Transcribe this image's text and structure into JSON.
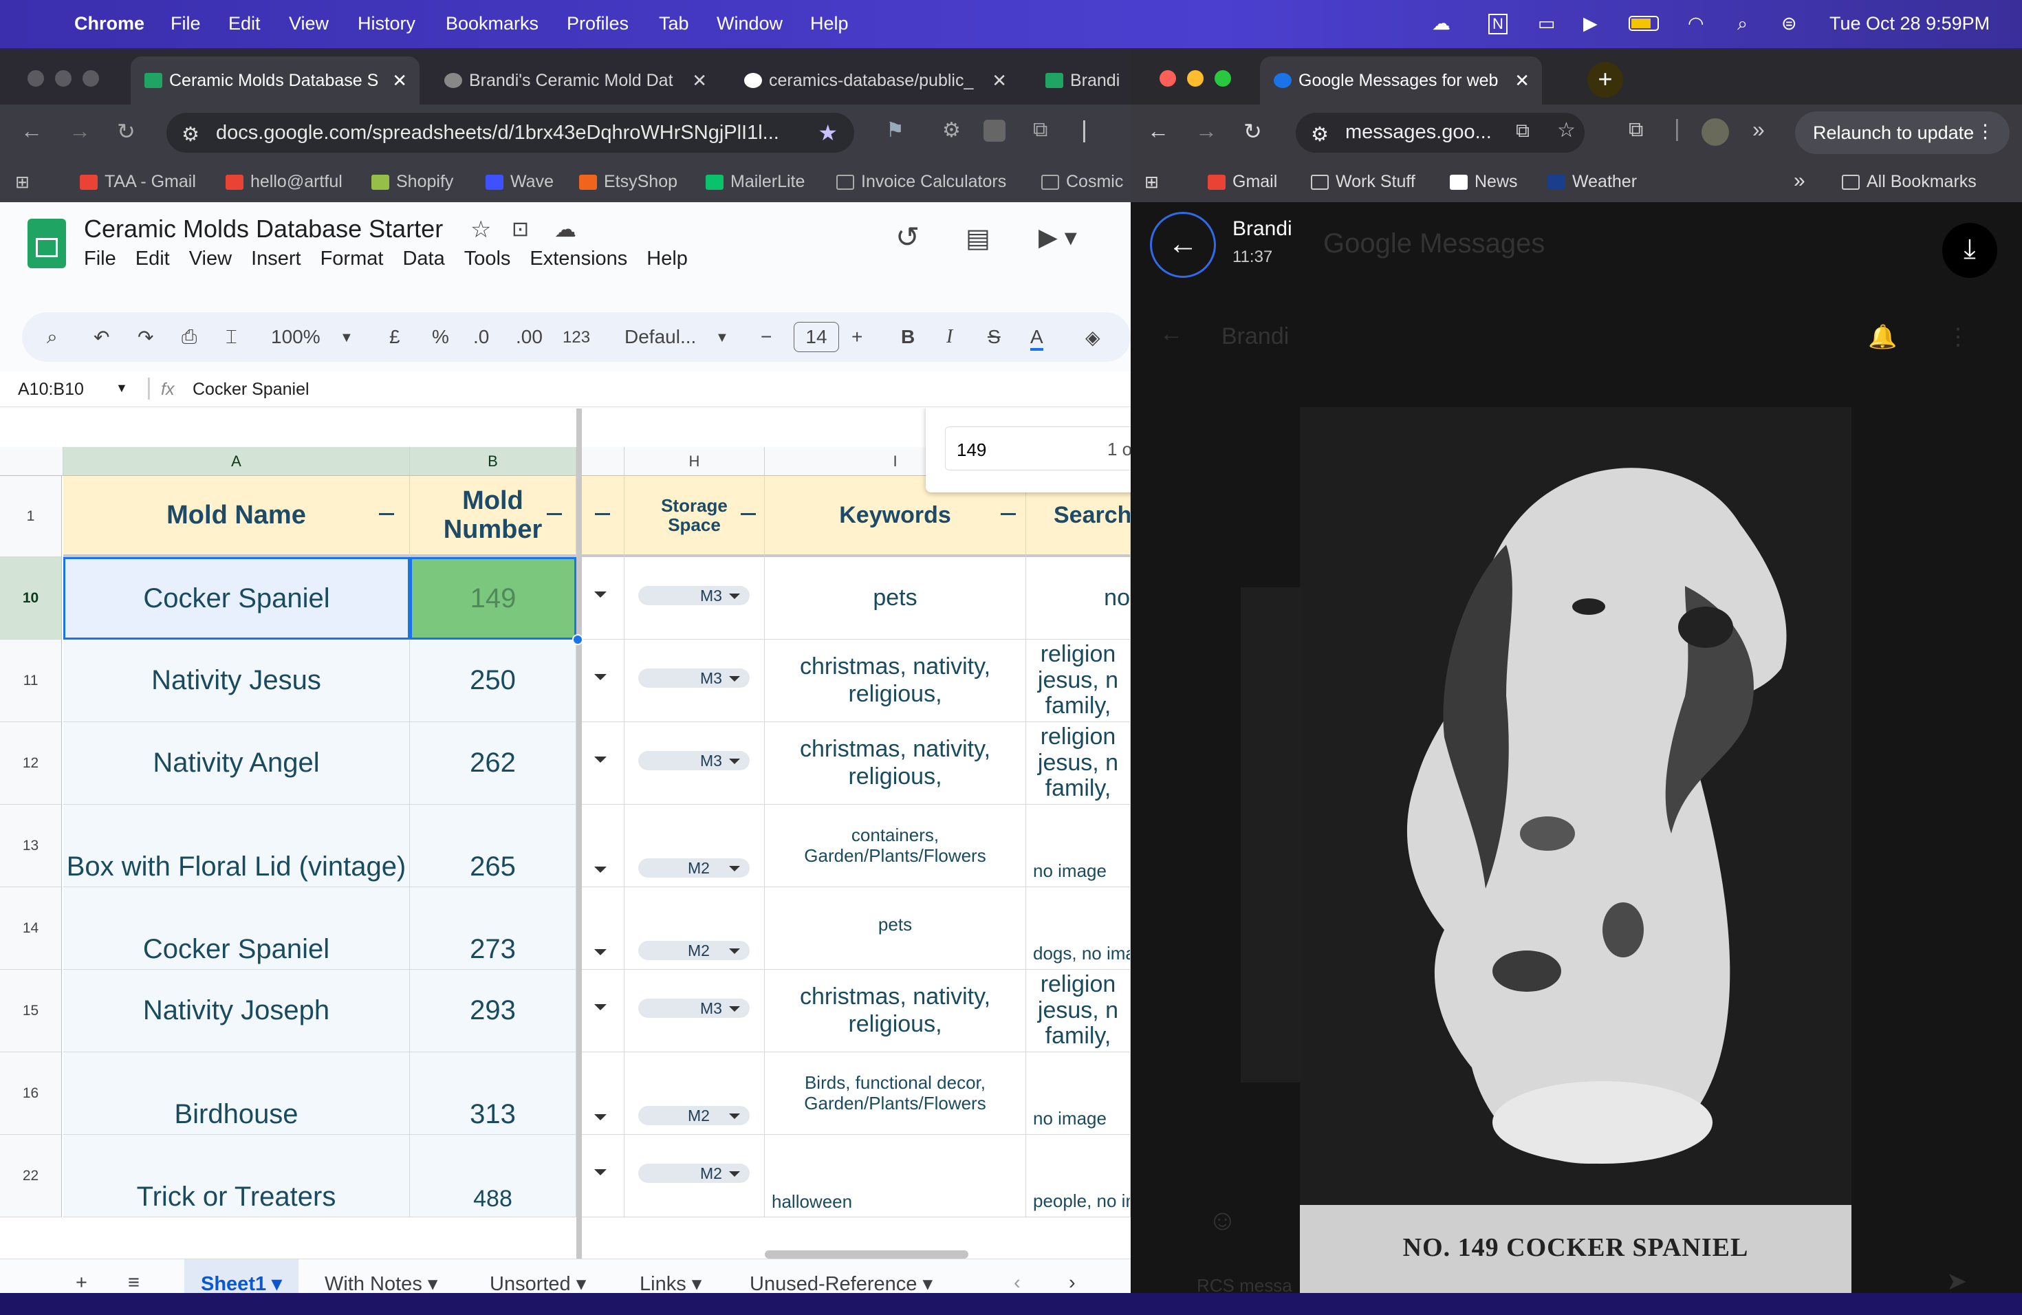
{
  "menubar": {
    "app": "Chrome",
    "items": [
      "File",
      "Edit",
      "View",
      "History",
      "Bookmarks",
      "Profiles",
      "Tab",
      "Window",
      "Help"
    ],
    "datetime": "Tue Oct 28  9:59PM"
  },
  "left": {
    "tabs": [
      "Ceramic Molds Database S",
      "Brandi's Ceramic Mold Dat",
      "ceramics-database/public_",
      "Brandi"
    ],
    "url": "docs.google.com/spreadsheets/d/1brx43eDqhroWHrSNgjPlI1l...",
    "bookmarks": [
      "TAA - Gmail",
      "hello@artful",
      "Shopify",
      "Wave",
      "EtsyShop",
      "MailerLite",
      "Invoice Calculators",
      "Cosmic"
    ],
    "doc_title": "Ceramic Molds Database Starter",
    "menus": [
      "File",
      "Edit",
      "View",
      "Insert",
      "Format",
      "Data",
      "Tools",
      "Extensions",
      "Help"
    ],
    "toolbar": {
      "zoom": "100%",
      "currency": "£",
      "percent": "%",
      "dec_less": ".0",
      "dec_more": ".00",
      "num_fmt": "123",
      "font": "Defaul...",
      "size": "14",
      "bold": "B",
      "italic": "I",
      "strike": "S",
      "color": "A"
    },
    "name_box": "A10:B10",
    "formula": "Cocker Spaniel",
    "find_value": "149",
    "find_count": "1 o",
    "col_headers": [
      "A",
      "B",
      "H",
      "I"
    ],
    "headers": {
      "a": "Mold Name",
      "b1": "Mold",
      "b2": "Number",
      "h1": "Storage",
      "h2": "Space",
      "i": "Keywords",
      "j": "Search"
    },
    "rows": [
      {
        "num": "10",
        "name": "Cocker Spaniel",
        "mold": "149",
        "storage": "M3",
        "kw": "pets",
        "search": "no"
      },
      {
        "num": "11",
        "name": "Nativity Jesus",
        "mold": "250",
        "storage": "M3",
        "kw": "christmas, nativity, religious,",
        "search": "religion jesus, n family,"
      },
      {
        "num": "12",
        "name": "Nativity Angel",
        "mold": "262",
        "storage": "M3",
        "kw": "christmas, nativity, religious,",
        "search": "religion jesus, n family,"
      },
      {
        "num": "13",
        "name": "Box with Floral Lid (vintage)",
        "mold": "265",
        "storage": "M2",
        "kw": "containers, Garden/Plants/Flowers",
        "search": "no image"
      },
      {
        "num": "14",
        "name": "Cocker Spaniel",
        "mold": "273",
        "storage": "M2",
        "kw": "pets",
        "search": "dogs, no ima"
      },
      {
        "num": "15",
        "name": "Nativity Joseph",
        "mold": "293",
        "storage": "M3",
        "kw": "christmas, nativity, religious,",
        "search": "religion jesus, n family,"
      },
      {
        "num": "16",
        "name": "Birdhouse",
        "mold": "313",
        "storage": "M2",
        "kw": "Birds, functional decor, Garden/Plants/Flowers",
        "search": "no image"
      },
      {
        "num": "22",
        "name": "Trick or Treaters",
        "mold": "488",
        "storage": "M2",
        "kw": "halloween",
        "search": "people, no im"
      }
    ],
    "sheet_tabs": [
      "Sheet1",
      "With Notes",
      "Unsorted",
      "Links",
      "Unused-Reference"
    ],
    "add_sheet": "+"
  },
  "right": {
    "tab": "Google Messages for web",
    "url": "messages.goo...",
    "relaunch": "Relaunch to update",
    "bookmarks": [
      "Gmail",
      "Work Stuff",
      "News",
      "Weather",
      "All Bookmarks"
    ],
    "sender": "Brandi",
    "time": "11:37",
    "bg_title": "Google Messages",
    "bg_contact": "Brandi",
    "photo_caption": "NO. 149 COCKER SPANIEL",
    "composer_hint": "RCS messa"
  }
}
